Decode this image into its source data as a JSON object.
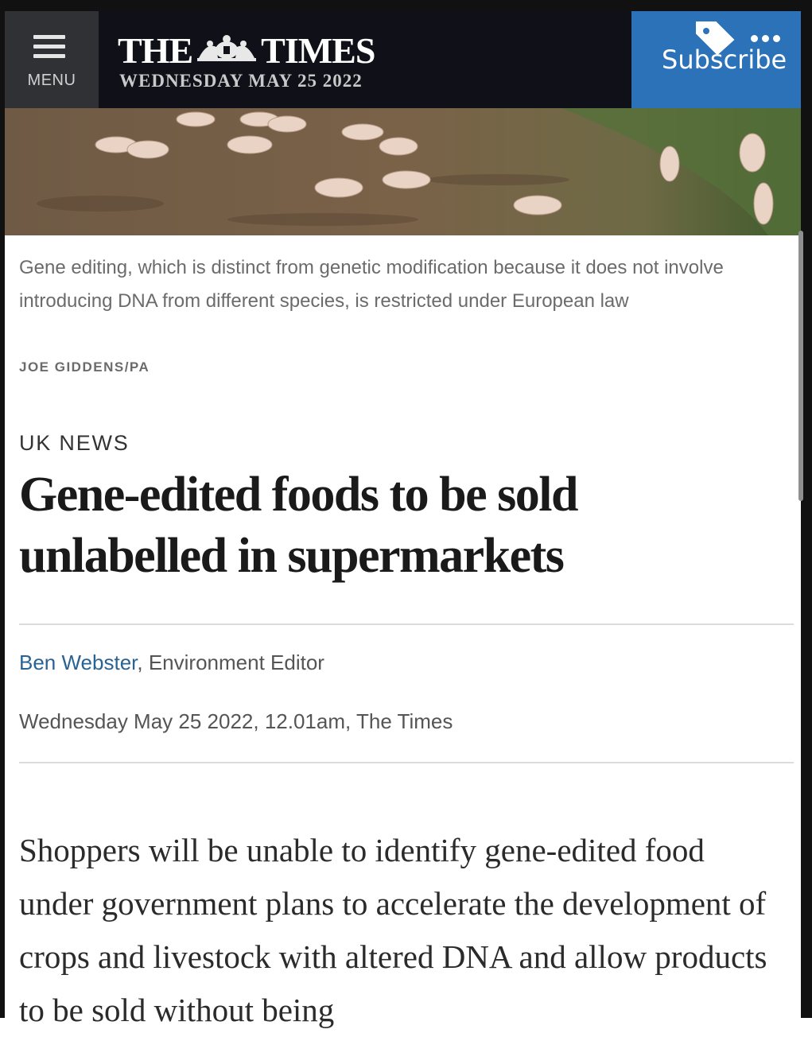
{
  "header": {
    "menu_label": "MENU",
    "logo_left": "THE",
    "logo_right": "TIMES",
    "date": "WEDNESDAY MAY 25 2022",
    "subscribe_label": "Subscribe",
    "subscribe_color": "#2b72b8",
    "background_color": "#0f1018"
  },
  "hero": {
    "image": "aerial-pigs-field"
  },
  "caption": {
    "text": "Gene editing, which is distinct from genetic modification because it does not involve introducing DNA from different species, is restricted under European law",
    "credit": "JOE GIDDENS/PA"
  },
  "article": {
    "section": "UK NEWS",
    "headline": "Gene-edited foods to be sold unlabelled in supermarkets",
    "author": "Ben Webster",
    "author_role": ", Environment Editor",
    "timestamp": "Wednesday May 25 2022, 12.01am, The Times",
    "body": "Shoppers will be unable to identify gene-edited food under government plans to accelerate the development of crops and livestock with altered DNA and allow products to be sold without being"
  },
  "icons": {
    "menu": "hamburger-icon",
    "tag": "tag-icon",
    "more": "more-dots-icon"
  }
}
